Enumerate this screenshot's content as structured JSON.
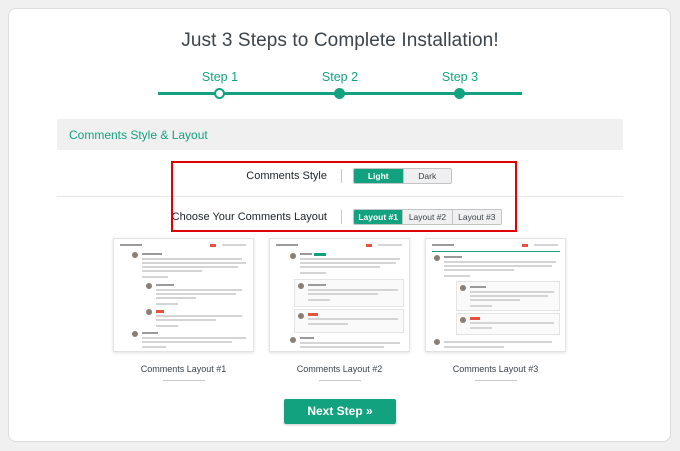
{
  "title": "Just 3 Steps to Complete Installation!",
  "steps": [
    {
      "label": "Step 1",
      "state": "current"
    },
    {
      "label": "Step 2",
      "state": "pending"
    },
    {
      "label": "Step 3",
      "state": "pending"
    }
  ],
  "section_title": "Comments Style & Layout",
  "style_row": {
    "label": "Comments Style",
    "options": [
      "Light",
      "Dark"
    ],
    "selected": "Light"
  },
  "layout_row": {
    "label": "Choose Your Comments Layout",
    "options": [
      "Layout #1",
      "Layout #2",
      "Layout #3"
    ],
    "selected": "Layout #1"
  },
  "layouts": [
    {
      "caption": "Comments Layout #1"
    },
    {
      "caption": "Comments Layout #2"
    },
    {
      "caption": "Comments Layout #3"
    }
  ],
  "next_button": "Next Step »",
  "colors": {
    "accent": "#12a27f",
    "highlight_border": "#e00000",
    "background": "#f0f0f1"
  }
}
